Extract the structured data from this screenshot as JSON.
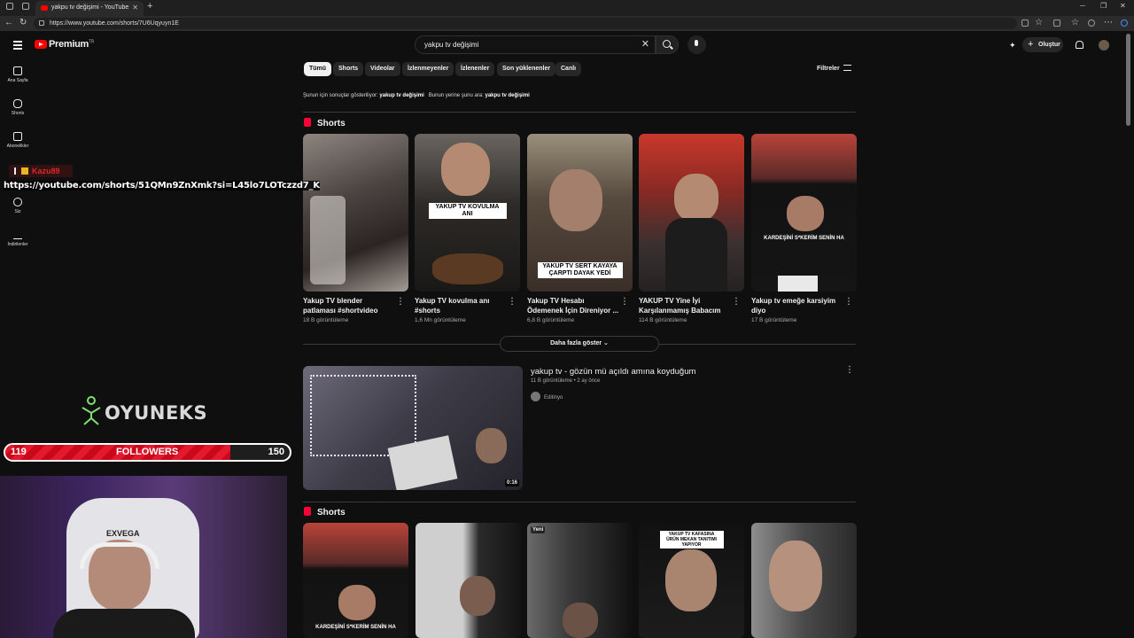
{
  "browser": {
    "tab_title": "yakpu tv değişimi - YouTube",
    "url": "https://www.youtube.com/shorts/7U6Uqyuyn1E"
  },
  "masthead": {
    "logo_text": "Premium",
    "logo_sup": "TR",
    "search_value": "yakpu tv değişimi",
    "create_label": "Oluştur"
  },
  "guide": [
    {
      "label": "Ana Sayfa",
      "icon": "home-icon"
    },
    {
      "label": "Shorts",
      "icon": "shorts-icon"
    },
    {
      "label": "Abonelikler",
      "icon": "subscriptions-icon"
    },
    {
      "label": "Siz",
      "icon": "you-icon"
    },
    {
      "label": "İndirilenler",
      "icon": "download-icon"
    }
  ],
  "chips": [
    "Tümü",
    "Shorts",
    "Videolar",
    "İzlenmeyenler",
    "İzlenenler",
    "Son yüklenenler",
    "Canlı"
  ],
  "filters_label": "Filtreler",
  "correction": {
    "prefix": "Şunun için sonuçlar gösteriliyor:",
    "corrected": "yakup tv değişimi",
    "instead": "Bunun yerine şunu ara:",
    "original": "yakpu tv değişimi"
  },
  "shelf1": {
    "title": "Shorts",
    "items": [
      {
        "title": "Yakup TV blender patlaması #shortvideo #yakuptv",
        "views": "18 B görüntüleme"
      },
      {
        "title": "Yakup TV kovulma anı #shorts",
        "views": "1,6 Mn görüntüleme",
        "caption": "YAKUP TV KOVULMA ANI"
      },
      {
        "title": "Yakup TV Hesabı Ödemenek İçin Direniyor ...",
        "views": "6,8 B görüntüleme",
        "caption": "YAKUP TV SERT KAYAYA ÇARPTI DAYAK YEDİ"
      },
      {
        "title": "YAKUP TV Yine İyi Karşılanmamış Babacım :)...",
        "views": "114 B görüntüleme"
      },
      {
        "title": "Yakup tv emeğe karsiyim diyo",
        "views": "17 B görüntüleme",
        "caption": "KARDEŞİNİ S*KERİM SENİN HA"
      }
    ],
    "more_label": "Daha fazla göster"
  },
  "video": {
    "title": "yakup tv - gözün mü açıldı amına koyduğum",
    "meta": "11 B görüntüleme • 2 ay önce",
    "channel": "Editinyo",
    "duration": "0:16"
  },
  "shelf2": {
    "title": "Shorts",
    "captions": [
      "KARDEŞİNİ S*KERİM SENİN HA",
      "Yeni",
      "YAKUP TV KAFASINA ÜRÜN MEKAN TANITIMI YAPIYOR"
    ]
  },
  "overlay": {
    "chat_user": "Kazu89",
    "link_text": "https://youtube.com/shorts/51QMn9ZnXmk?si=L45lo7LOTczzd7_K",
    "brand": "OYUNEKS",
    "followers_current": "119",
    "followers_label": "FOLLOWERS",
    "followers_goal": "150",
    "followers_progress": 0.79,
    "chair_brand": "EXVEGA"
  },
  "colors": {
    "bg": "#0f0f0f",
    "accent": "#ff0000",
    "follower_bar": "#e5192d"
  }
}
